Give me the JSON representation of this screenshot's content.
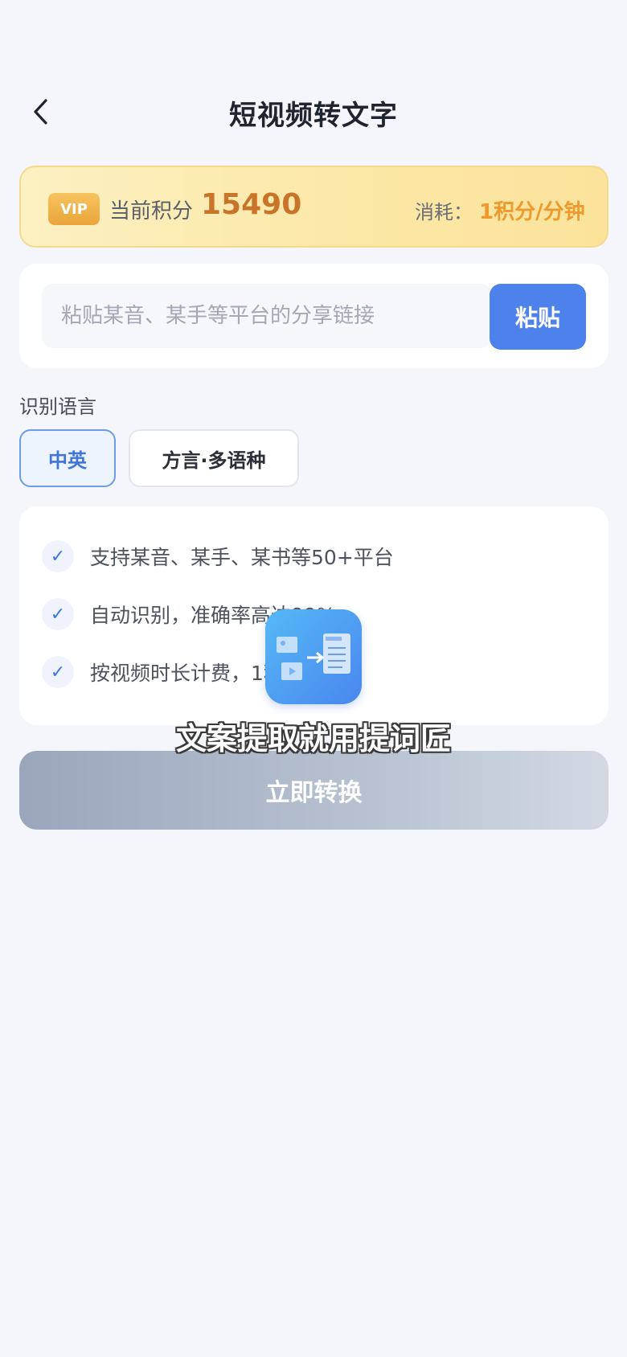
{
  "header": {
    "title": "短视频转文字",
    "back_icon": "chevron-left-icon"
  },
  "vip": {
    "badge": "VIP",
    "points_label": "当前积分",
    "points_value": "15490",
    "cost_label": "消耗：",
    "cost_value": "1积分/分钟",
    "accent_color": "#c8752a"
  },
  "link": {
    "placeholder": "粘贴某音、某手等平台的分享链接",
    "paste_label": "粘贴"
  },
  "language": {
    "label": "识别语言",
    "options": [
      {
        "label": "中英",
        "selected": true
      },
      {
        "label": "方言·多语种",
        "selected": false
      }
    ]
  },
  "features": {
    "check_glyph": "✓",
    "items": [
      "支持某音、某手、某书等50+平台",
      "自动识别，准确率高达99%",
      "按视频时长计费，1积分/分钟"
    ]
  },
  "watermark": {
    "text": "文案提取就用提词匠",
    "logo_icon": "image-to-text-app-icon"
  },
  "actions": {
    "convert_label": "立即转换"
  }
}
